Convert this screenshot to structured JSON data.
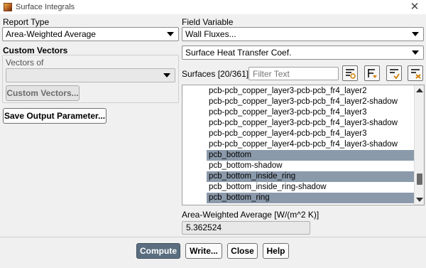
{
  "window": {
    "title": "Surface Integrals",
    "close_glyph": "✕"
  },
  "report_type": {
    "label": "Report Type",
    "value": "Area-Weighted Average"
  },
  "custom_vectors": {
    "heading": "Custom Vectors",
    "vectors_of_label": "Vectors of",
    "vectors_of_value": "",
    "button": "Custom Vectors..."
  },
  "save_output_button": "Save Output Parameter...",
  "field_variable": {
    "label": "Field Variable",
    "category": "Wall Fluxes...",
    "variable": "Surface Heat Transfer Coef."
  },
  "surfaces": {
    "label": "Surfaces",
    "count": "[20/361]",
    "filter_placeholder": "Filter Text",
    "tools": [
      "select-all-icon",
      "filter-icon",
      "check-selected-icon",
      "deselect-all-icon"
    ],
    "items": [
      {
        "name": "pcb-pcb_copper_layer3-pcb-pcb_fr4_layer2",
        "selected": false
      },
      {
        "name": "pcb-pcb_copper_layer3-pcb-pcb_fr4_layer2-shadow",
        "selected": false
      },
      {
        "name": "pcb-pcb_copper_layer3-pcb-pcb_fr4_layer3",
        "selected": false
      },
      {
        "name": "pcb-pcb_copper_layer3-pcb-pcb_fr4_layer3-shadow",
        "selected": false
      },
      {
        "name": "pcb-pcb_copper_layer4-pcb-pcb_fr4_layer3",
        "selected": false
      },
      {
        "name": "pcb-pcb_copper_layer4-pcb-pcb_fr4_layer3-shadow",
        "selected": false
      },
      {
        "name": "pcb_bottom",
        "selected": true
      },
      {
        "name": "pcb_bottom-shadow",
        "selected": false
      },
      {
        "name": "pcb_bottom_inside_ring",
        "selected": true
      },
      {
        "name": "pcb_bottom_inside_ring-shadow",
        "selected": false
      },
      {
        "name": "pcb_bottom_ring",
        "selected": true
      }
    ]
  },
  "result": {
    "label": "Area-Weighted Average [W/(m^2 K)]",
    "value": "5.362524"
  },
  "buttons": {
    "compute": "Compute",
    "write": "Write...",
    "close": "Close",
    "help": "Help"
  },
  "colors": {
    "selection": "#8b9aab",
    "primary_button": "#5a6e80"
  }
}
